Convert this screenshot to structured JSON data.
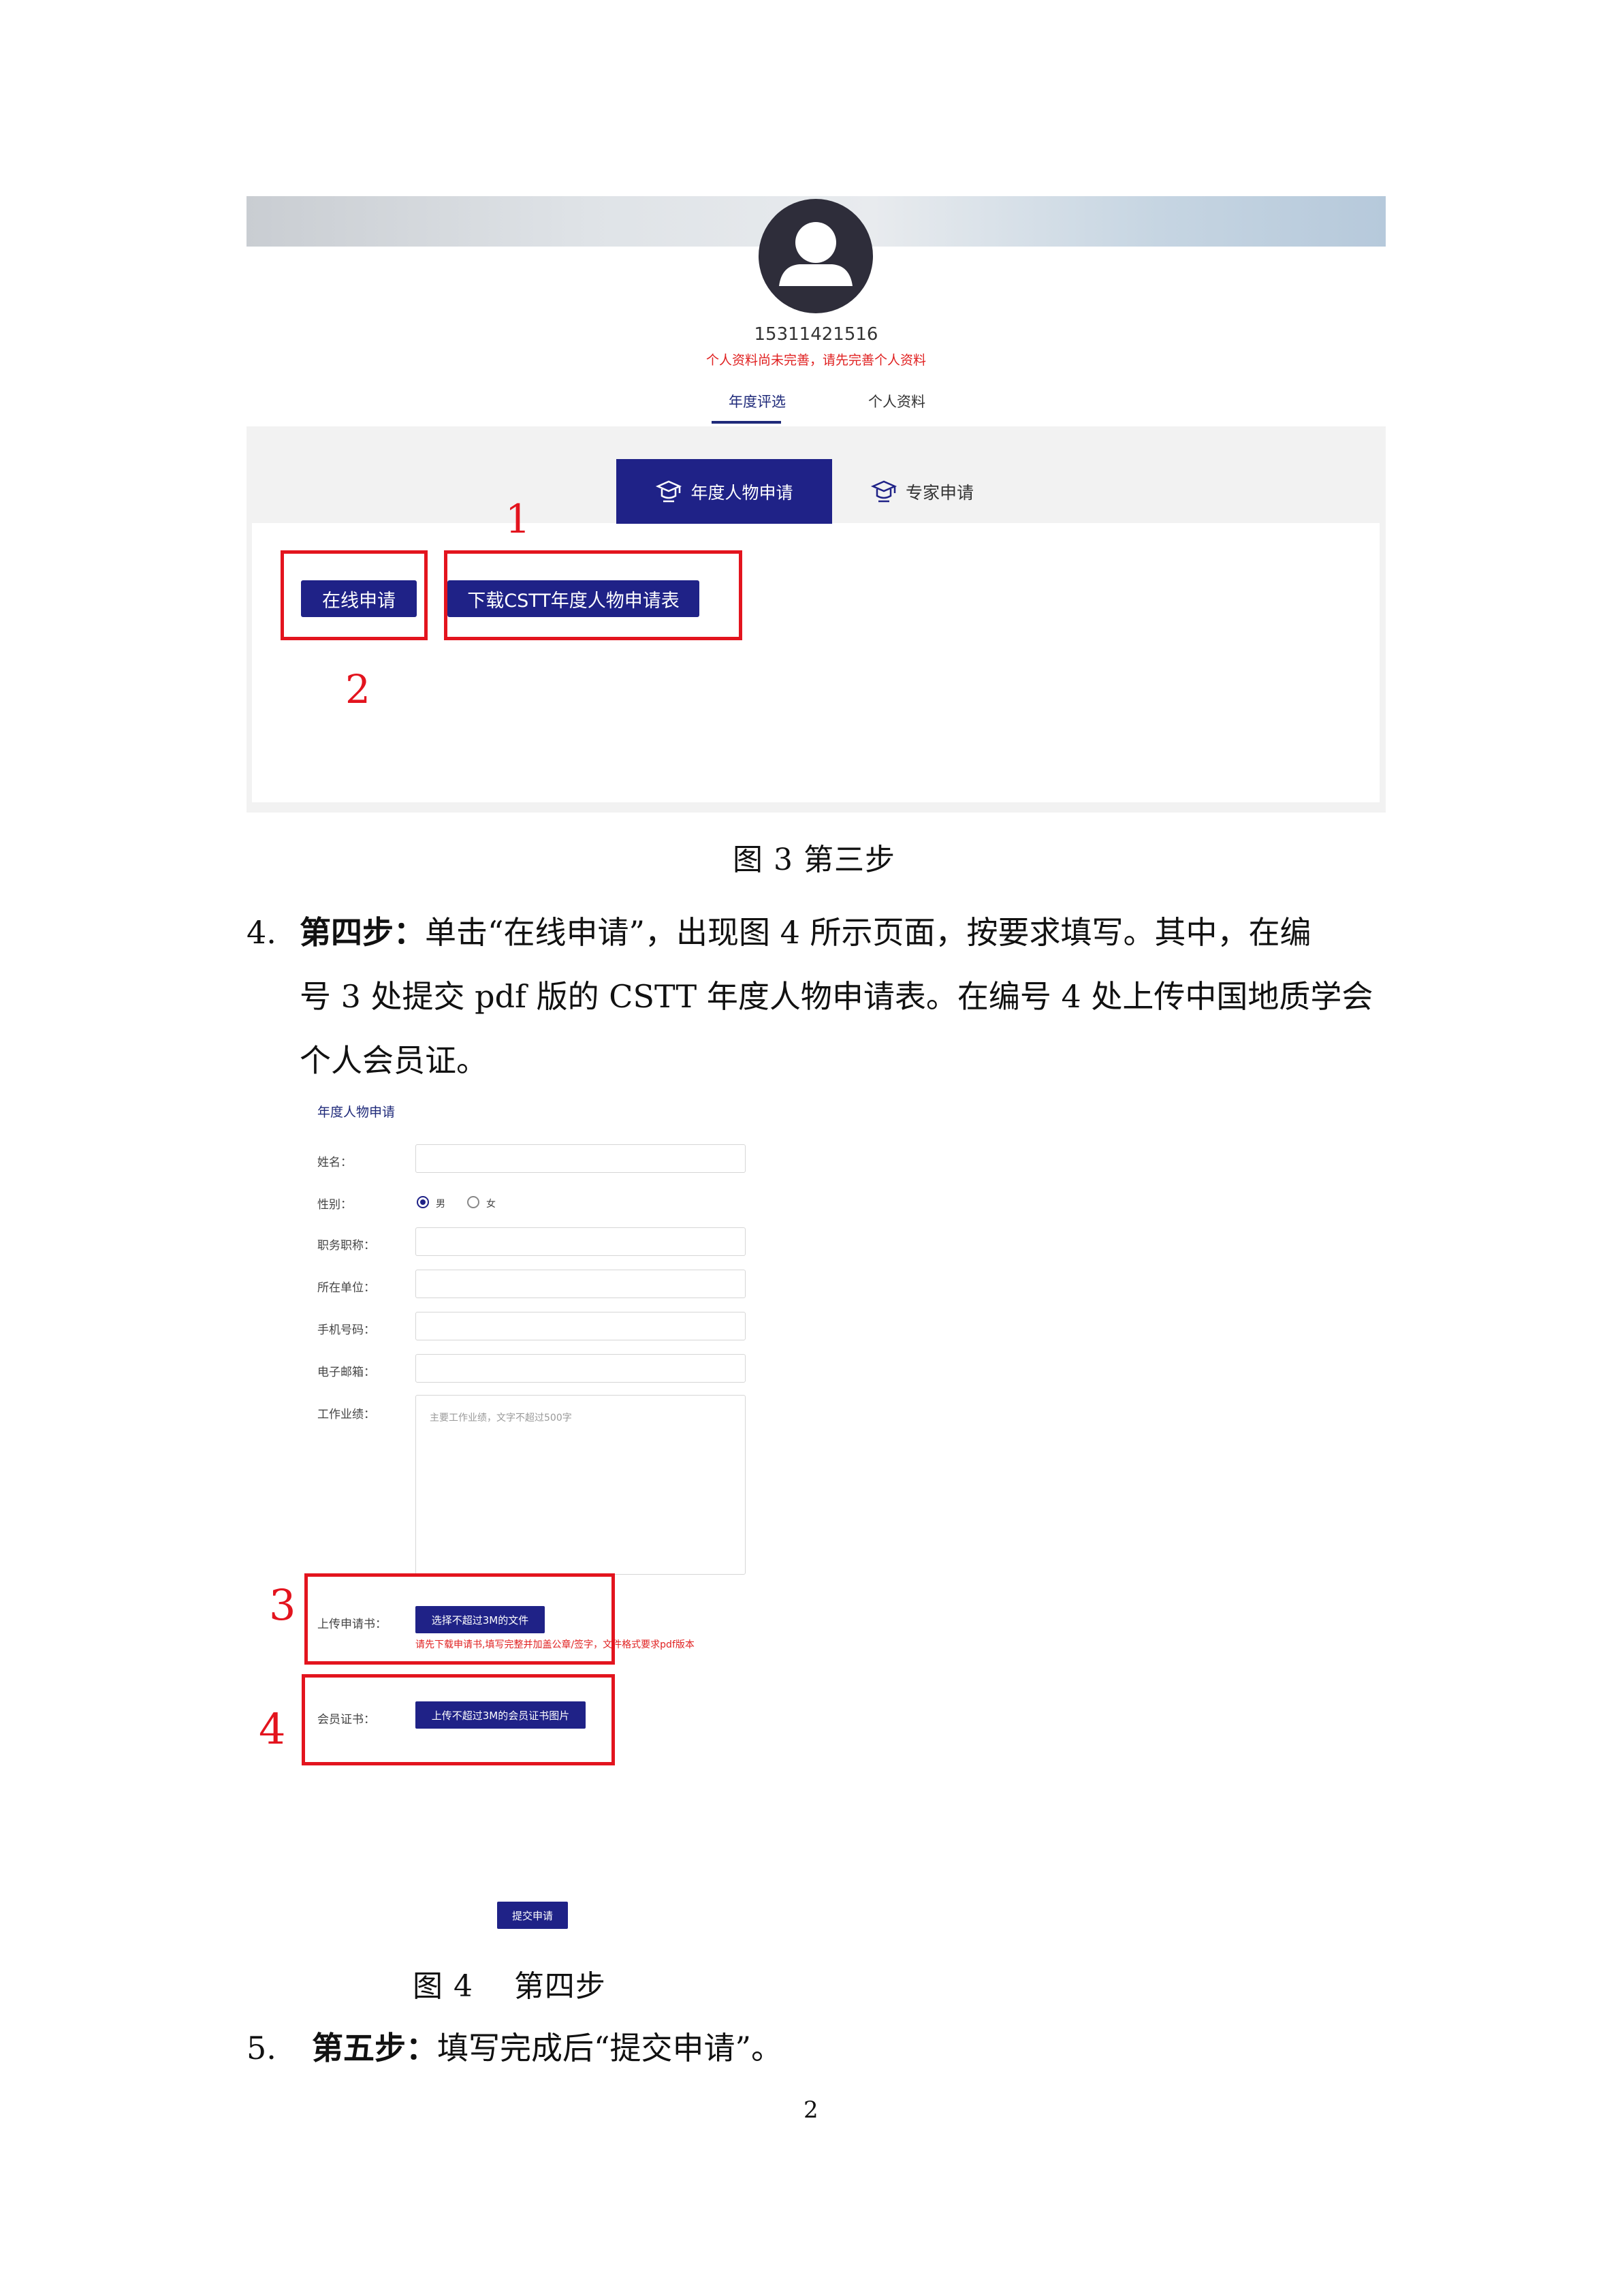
{
  "figure3": {
    "phone": "15311421516",
    "warning": "个人资料尚未完善，请先完善个人资料",
    "tabs": [
      "年度评选",
      "个人资料"
    ],
    "segments": [
      "年度人物申请",
      "专家申请"
    ],
    "buttons": {
      "online_apply": "在线申请",
      "download_form": "下载CSTT年度人物申请表"
    },
    "annotations": [
      "1",
      "2"
    ]
  },
  "caption3": "图 3  第三步",
  "step4": {
    "num": "4.",
    "label": "第四步：",
    "line1": "单击“在线申请”，出现图 4 所示页面，按要求填写。其中，在编",
    "line2": "号 3 处提交 pdf 版的 CSTT 年度人物申请表。在编号 4 处上传中国地质学会",
    "line3": "个人会员证。"
  },
  "figure4": {
    "title": "年度人物申请",
    "labels": {
      "name": "姓名：",
      "gender": "性别：",
      "title": "职务职称：",
      "unit": "所在单位：",
      "mobile": "手机号码：",
      "email": "电子邮箱：",
      "achievements": "工作业绩：",
      "upload_form": "上传申请书：",
      "member_cert": "会员证书："
    },
    "gender_options": [
      "男",
      "女"
    ],
    "gender_selected": "男",
    "achievements_placeholder": "主要工作业绩，文字不超过500字",
    "upload_button": "选择不超过3M的文件",
    "upload_hint": "请先下载申请书,填写完整并加盖公章/签字，文件格式要求pdf版本",
    "cert_button": "上传不超过3M的会员证书图片",
    "submit_button": "提交申请",
    "annotations": [
      "3",
      "4"
    ]
  },
  "caption4": "图 4    第四步",
  "step5": {
    "num": "5.",
    "label": "第五步：",
    "text": "填写完成后“提交申请”。"
  },
  "page_number": "2"
}
